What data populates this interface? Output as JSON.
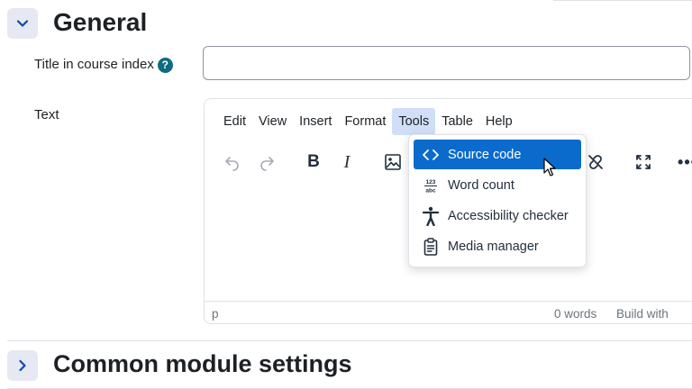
{
  "general_section": {
    "title": "General",
    "title_field_label": "Title in course index",
    "help_icon_glyph": "?",
    "text_field_label": "Text"
  },
  "editor": {
    "menus": [
      {
        "label": "Edit"
      },
      {
        "label": "View"
      },
      {
        "label": "Insert"
      },
      {
        "label": "Format"
      },
      {
        "label": "Tools",
        "active": true
      },
      {
        "label": "Table"
      },
      {
        "label": "Help"
      }
    ],
    "toolbar": {
      "bold_label": "B",
      "italic_label": "I",
      "more_label": "•••",
      "icons": [
        "undo-icon",
        "redo-icon",
        "image-icon",
        "unlink-icon",
        "fullscreen-icon"
      ]
    },
    "statusbar": {
      "path": "p",
      "word_count": "0 words",
      "build_with": "Build with"
    }
  },
  "tools_menu": {
    "items": [
      {
        "label": "Source code",
        "icon": "source-code-icon",
        "selected": true
      },
      {
        "label": "Word count",
        "icon": "word-count-icon",
        "selected": false
      },
      {
        "label": "Accessibility checker",
        "icon": "accessibility-icon",
        "selected": false
      },
      {
        "label": "Media manager",
        "icon": "media-manager-icon",
        "selected": false
      }
    ]
  },
  "common_section": {
    "title": "Common module settings"
  },
  "colors": {
    "accent": "#0f47ad",
    "toggle_bg": "#e6e8f3",
    "help_icon": "#0f6c80",
    "menu_active_bg": "#d0dff7",
    "dropdown_selected": "#0a6bcd"
  }
}
